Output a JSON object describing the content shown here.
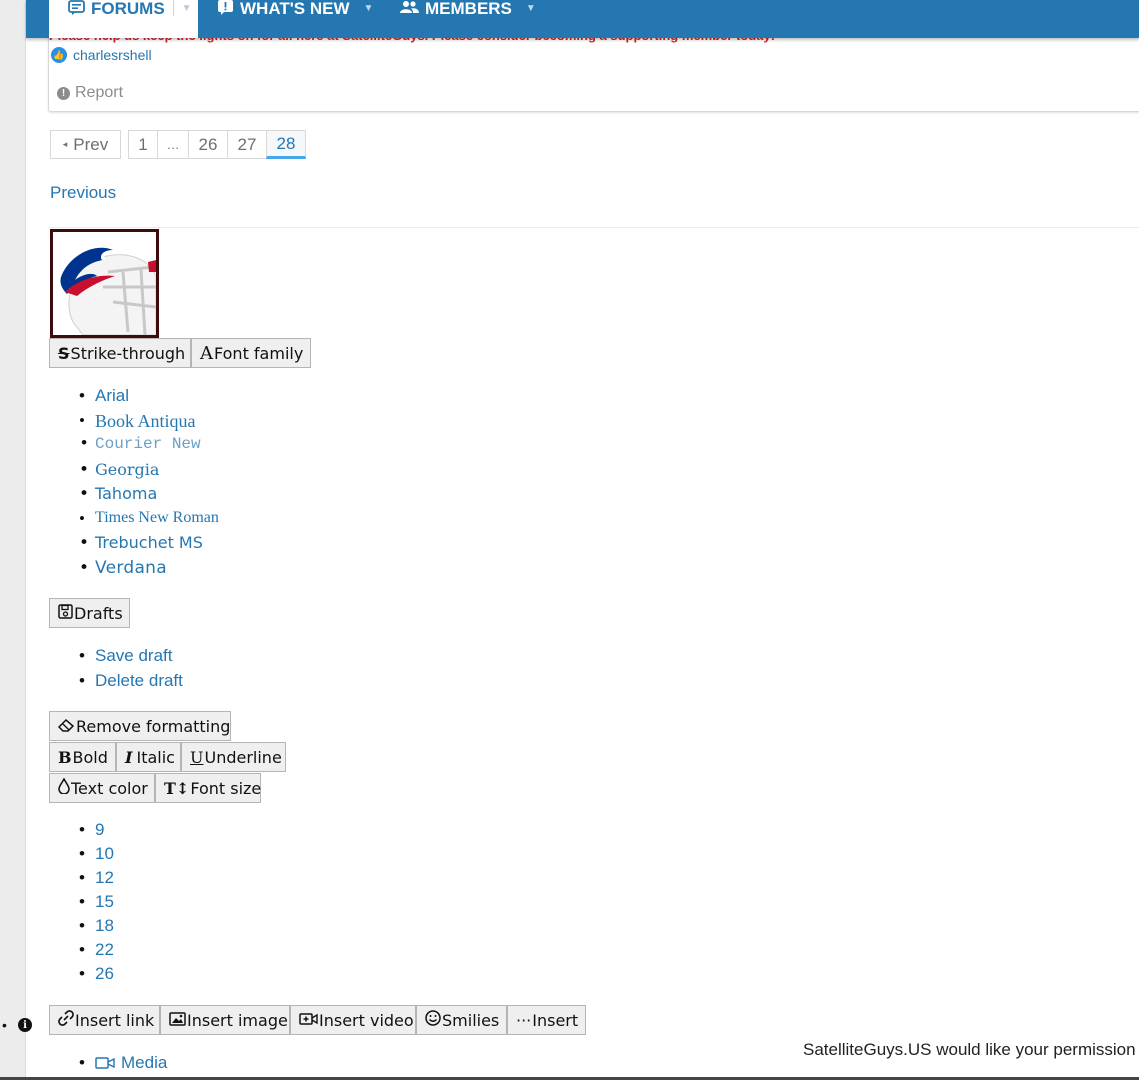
{
  "nav": {
    "tabs": [
      {
        "label": "FORUMS",
        "icon": "forum-bubble-icon"
      },
      {
        "label": "WHAT'S NEW",
        "icon": "alert-bubble-icon"
      },
      {
        "label": "MEMBERS",
        "icon": "people-icon"
      }
    ],
    "colors": {
      "bar": "#2577b1",
      "active_text": "#2577b1"
    }
  },
  "post": {
    "signature_text": "Please help us keep the lights on for all here at SatelliteGuys. Please consider becoming a supporting member today!",
    "likes_user": "charlesrshell",
    "report_label": "Report"
  },
  "pagination": {
    "prev_label": "Prev",
    "pages": [
      "1",
      "…",
      "26",
      "27",
      "28"
    ],
    "current": "28"
  },
  "previous_link": "Previous",
  "editor": {
    "strike_label": "Strike-through",
    "font_family_label": "Font family",
    "font_families": [
      "Arial",
      "Book Antiqua",
      "Courier New",
      "Georgia",
      "Tahoma",
      "Times New Roman",
      "Trebuchet MS",
      "Verdana"
    ],
    "drafts_label": "Drafts",
    "draft_items": [
      "Save draft",
      "Delete draft"
    ],
    "remove_formatting_label": "Remove formatting",
    "bold_label": "Bold",
    "italic_label": "Italic",
    "underline_label": "Underline",
    "text_color_label": "Text color",
    "font_size_label": "Font size",
    "font_sizes": [
      "9",
      "10",
      "12",
      "15",
      "18",
      "22",
      "26"
    ],
    "insert_link_label": "Insert link",
    "insert_image_label": "Insert image",
    "insert_video_label": "Insert video",
    "smilies_label": "Smilies",
    "insert_label": "Insert",
    "media_label": "Media"
  },
  "consent_text": "SatelliteGuys.US would like your permission"
}
